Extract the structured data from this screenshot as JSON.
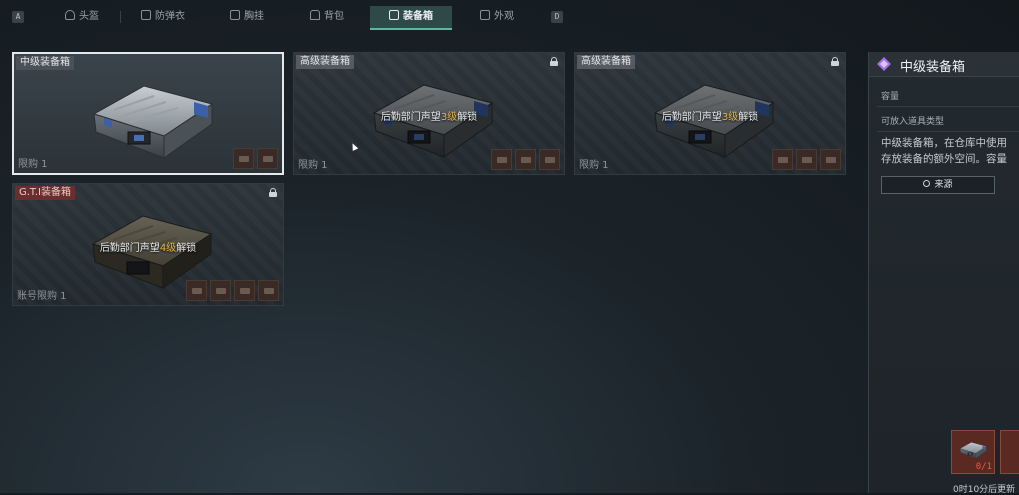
{
  "tabs": {
    "key_left": "A",
    "key_right": "D",
    "items": [
      {
        "label": "头盔",
        "icon": "helmet-icon"
      },
      {
        "label": "防弹衣",
        "icon": "vest-icon"
      },
      {
        "label": "胸挂",
        "icon": "chest-rig-icon"
      },
      {
        "label": "背包",
        "icon": "backpack-icon"
      },
      {
        "label": "装备箱",
        "icon": "case-icon",
        "active": true
      },
      {
        "label": "外观",
        "icon": "appearance-icon"
      }
    ]
  },
  "cards": [
    {
      "label": "中级装备箱",
      "limit": "限购 1",
      "selected": true,
      "locked": false
    },
    {
      "label": "高级装备箱",
      "limit": "限购 1",
      "locked": true,
      "unlock_pre": "后勤部门声望",
      "unlock_num": "3级",
      "unlock_post": "解锁"
    },
    {
      "label": "高级装备箱",
      "limit": "限购 1",
      "locked": true,
      "unlock_pre": "后勤部门声望",
      "unlock_num": "3级",
      "unlock_post": "解锁"
    },
    {
      "label": "G.T.I装备箱",
      "limit": "账号限购 1",
      "locked": true,
      "unlock_pre": "后勤部门声望",
      "unlock_num": "4级",
      "unlock_post": "解锁"
    }
  ],
  "panel": {
    "title": "中级装备箱",
    "capacity_label": "容量",
    "item_type_label": "可放入道具类型",
    "desc_line1": "中级装备箱，在仓库中使用",
    "desc_line2": "存放装备的额外空间。容量",
    "source_label": "来源",
    "item_count": "0/1",
    "refresh_text": "0时10分后更新"
  },
  "colors": {
    "accent_active_tab": "#58b8a0",
    "unlock_highlight": "#e8b84a",
    "danger_count": "#e45a4a",
    "rarity_purple": "#a070e0"
  }
}
